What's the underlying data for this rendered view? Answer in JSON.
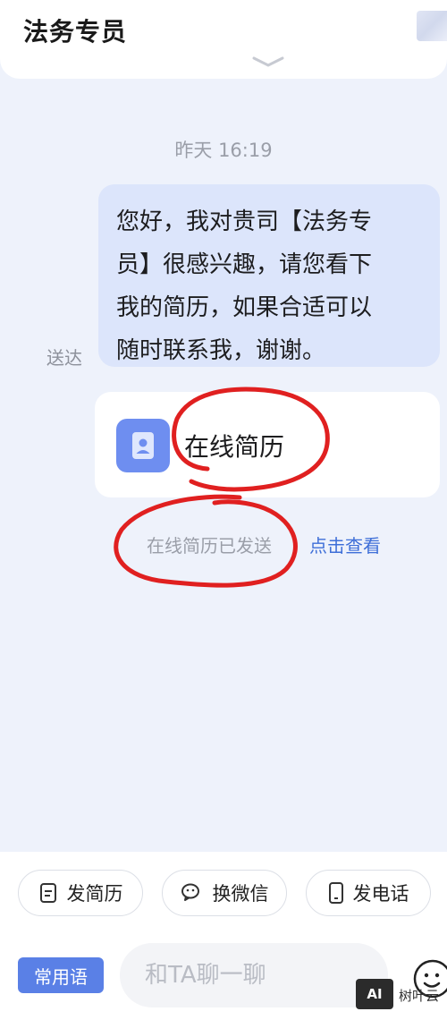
{
  "header": {
    "title": "法务专员",
    "collapse_icon": "chevron-down-icon"
  },
  "chat": {
    "timestamp": "昨天 16:19",
    "message": {
      "lines": [
        "您好，我对贵司【法务专",
        "员】很感兴趣，请您看下",
        "我的简历，如果合适可以",
        "随时联系我，谢谢。"
      ],
      "status": "送达"
    },
    "resume_card": {
      "label": "在线简历",
      "icon": "resume-icon"
    },
    "system_note": {
      "text": "在线简历已发送",
      "link": "点击查看"
    }
  },
  "quick_actions": [
    {
      "label": "发简历",
      "icon": "document-icon"
    },
    {
      "label": "换微信",
      "icon": "wechat-icon"
    },
    {
      "label": "发电话",
      "icon": "phone-icon"
    }
  ],
  "composer": {
    "phrases_label": "常用语",
    "placeholder": "和TA聊一聊",
    "emoji_icon": "emoji-icon"
  },
  "watermark": {
    "badge": "AI",
    "text": "树叶云"
  },
  "colors": {
    "accent": "#5a80e6",
    "link": "#3e6fd8",
    "bubble": "#dce5fb",
    "background": "#eef2fb",
    "annotation": "#e02020"
  }
}
